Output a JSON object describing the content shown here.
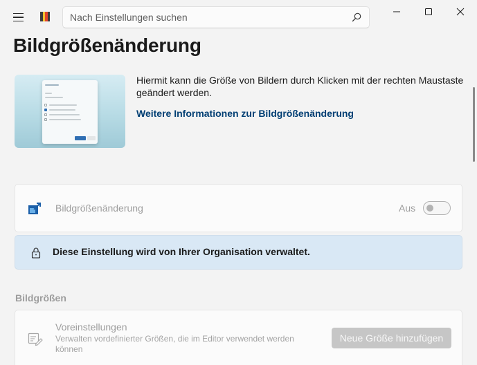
{
  "titlebar": {
    "search_placeholder": "Nach Einstellungen suchen"
  },
  "page": {
    "title": "Bildgrößenänderung"
  },
  "hero": {
    "description": "Hiermit kann die Größe von Bildern durch Klicken mit der rechten Maustaste geändert werden.",
    "link": "Weitere Informationen zur Bildgrößenänderung"
  },
  "toggle_card": {
    "label": "Bildgrößenänderung",
    "state_label": "Aus",
    "enabled": false
  },
  "infobar": {
    "text": "Diese Einstellung wird von Ihrer Organisation verwaltet."
  },
  "sizes_section": {
    "title": "Bildgrößen",
    "presets_title": "Voreinstellungen",
    "presets_desc": "Verwalten vordefinierter Größen, die im Editor verwendet werden können",
    "add_button": "Neue Größe hinzufügen"
  },
  "colors": {
    "accent": "#003e73",
    "infobar_bg": "#d9e8f5",
    "disabled_text": "#9d9d9d"
  }
}
